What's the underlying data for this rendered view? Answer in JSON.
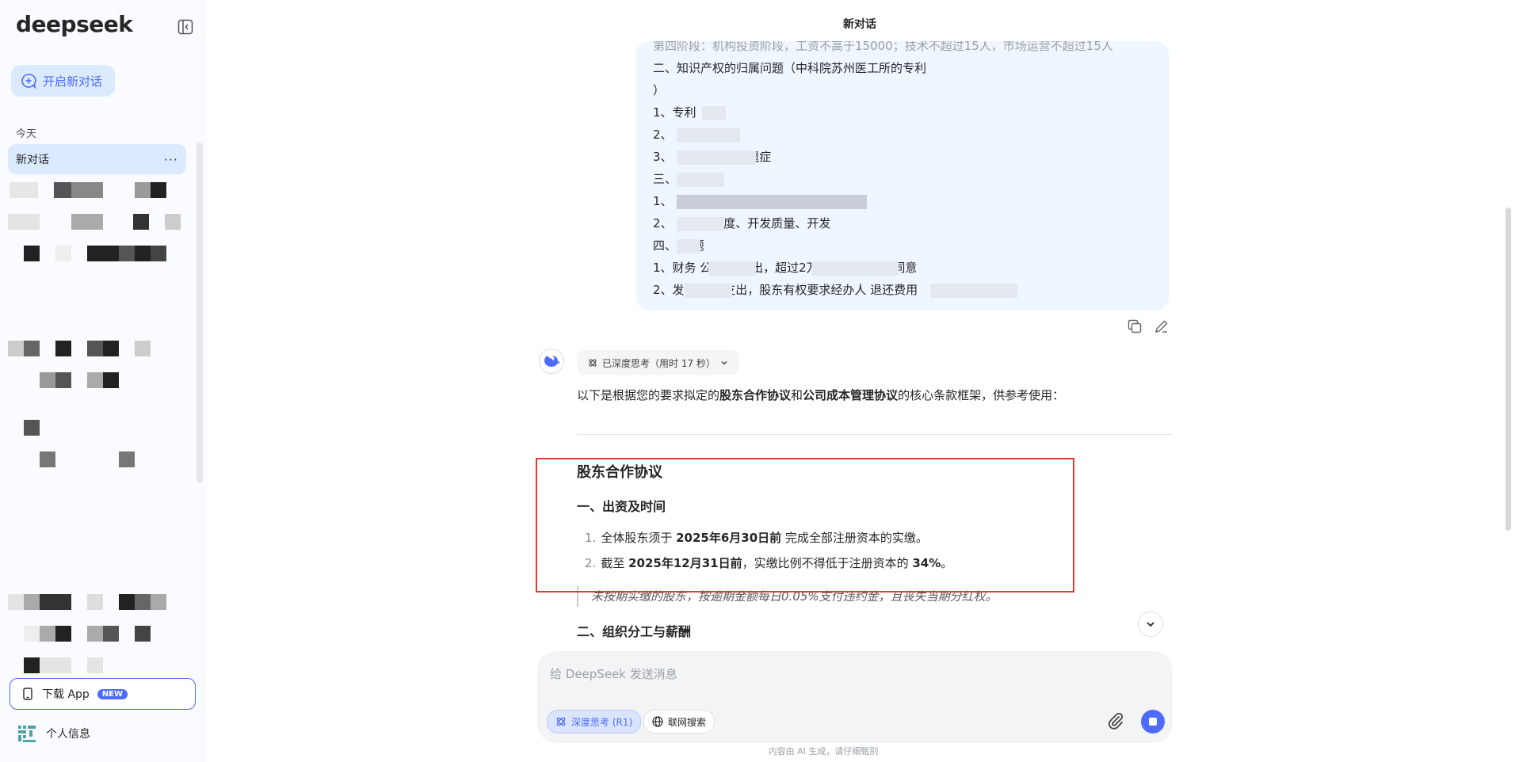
{
  "app": {
    "logo": "deepseek",
    "page_title": "新对话"
  },
  "colors": {
    "accent": "#4d6bfe",
    "highlight_box": "#e53935",
    "sidebar_bg": "#f9fbff",
    "bubble_bg": "#eff6ff"
  },
  "sidebar": {
    "new_chat_label": "开启新对话",
    "section_today": "今天",
    "active_chat": "新对话",
    "more_icon": "···",
    "download_app": "下载 App",
    "download_badge": "NEW",
    "profile_label": "个人信息"
  },
  "user_message": {
    "lines": [
      "第四阶段：机构投资阶段，工资不高于15000；技术不超过15人，市场运营不超过15人",
      "二、知识产权的归属问题（中科院苏州医工所的专利",
      "）",
      "1、专利",
      "2、",
      "3、              不能有产权后遗症",
      "三、",
      "1、",
      "2、              的开发进度、开发质量、开发",
      "四、   问题",
      "1、财务     公司财         支出，超过2万         需要所有股东同意",
      "2、发             理账务支出，股东有权要求经办人       退还费用"
    ]
  },
  "assistant": {
    "think_label": "已深度思考（用时 17 秒）",
    "intro_prefix": "以下是根据您的要求拟定的",
    "intro_bold1": "股东合作协议",
    "intro_mid": "和",
    "intro_bold2": "公司成本管理协议",
    "intro_suffix": "的核心条款框架，供参考使用：",
    "doc_title": "股东合作协议",
    "section1": "一、出资及时间",
    "items": [
      {
        "num": "1.",
        "pre": "全体股东须于 ",
        "bold": "2025年6月30日前",
        "post": " 完成全部注册资本的实缴。"
      },
      {
        "num": "2.",
        "pre": "截至 ",
        "bold": "2025年12月31日前",
        "post": "，实缴比例不得低于注册资本的 ",
        "bold2": "34%",
        "post2": "。"
      }
    ],
    "quote": "未按期实缴的股东，按逾期金额每日0.05%支付违约金，且丧失当期分红权。",
    "section2": "二、组织分工与薪酬"
  },
  "composer": {
    "placeholder": "给 DeepSeek 发送消息",
    "deep_think": "深度思考 (R1)",
    "web_search": "联网搜索"
  },
  "disclaimer": "内容由 AI 生成，请仔细甄别"
}
